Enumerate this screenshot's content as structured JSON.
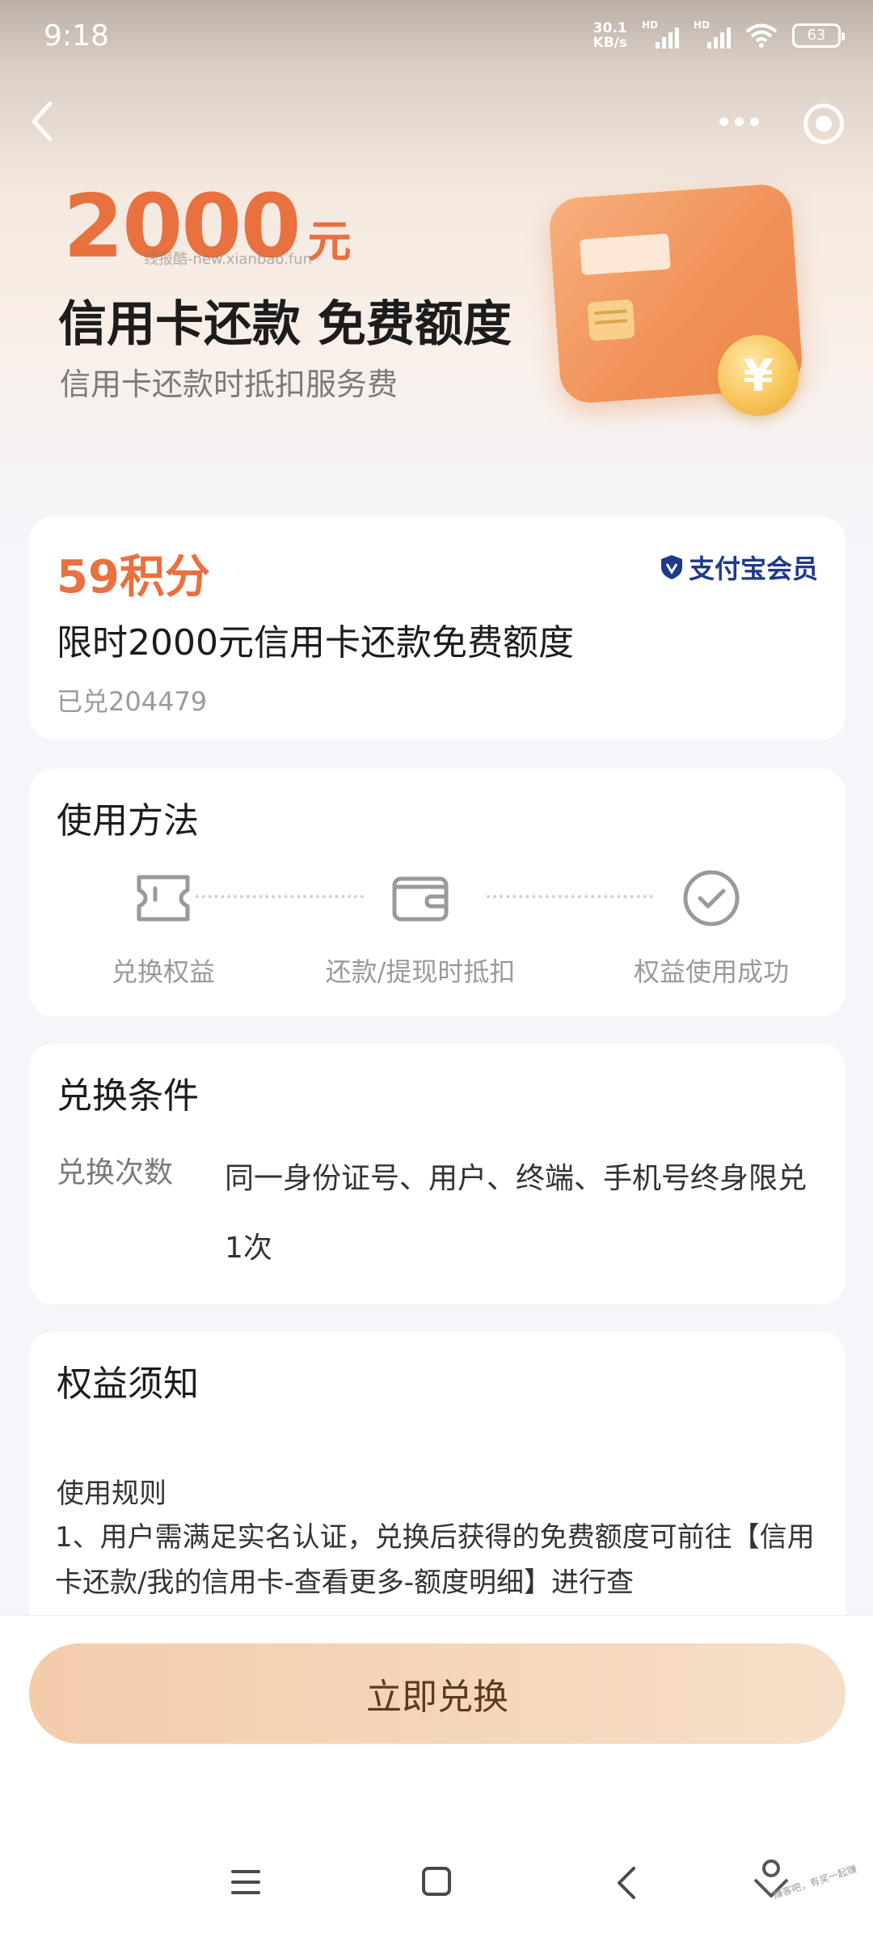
{
  "status_bar": {
    "time": "9:18",
    "net_speed_value": "30.1",
    "net_speed_unit": "KB/s",
    "signal1_label": "HD",
    "signal2_label": "HD",
    "battery": "63"
  },
  "nav": {
    "back_icon": "chevron-left-icon",
    "more_icon": "more-dots-icon",
    "close_icon": "close-circle-icon"
  },
  "hero": {
    "amount": "2000",
    "unit": "元",
    "watermark": "线报酷-new.xianbao.fun",
    "title": "信用卡还款 免费额度",
    "subtitle": "信用卡还款时抵扣服务费",
    "coin_symbol": "¥"
  },
  "offer": {
    "points": "59积分",
    "brand": "支付宝会员",
    "title": "限时2000元信用卡还款免费额度",
    "redeemed": "已兑204479"
  },
  "usage": {
    "title": "使用方法",
    "steps": [
      {
        "label": "兑换权益",
        "icon": "ticket-icon"
      },
      {
        "label": "还款/提现时抵扣",
        "icon": "wallet-icon"
      },
      {
        "label": "权益使用成功",
        "icon": "check-circle-icon"
      }
    ]
  },
  "conditions": {
    "title": "兑换条件",
    "label": "兑换次数",
    "value": "同一身份证号、用户、终端、手机号终身限兑1次"
  },
  "notice": {
    "title": "权益须知",
    "rules_heading": "使用规则",
    "rules_text": "1、用户需满足实名认证，兑换后获得的免费额度可前往【信用卡还款/我的信用卡-查看更多-额度明细】进行查"
  },
  "action": {
    "redeem_label": "立即兑换"
  },
  "system_nav": {
    "badge_text": "赚客吧，有奖一起赚"
  },
  "colors": {
    "accent": "#e8713f",
    "brand_blue": "#1e3a8a",
    "button_bg": "#f3ccaa"
  }
}
